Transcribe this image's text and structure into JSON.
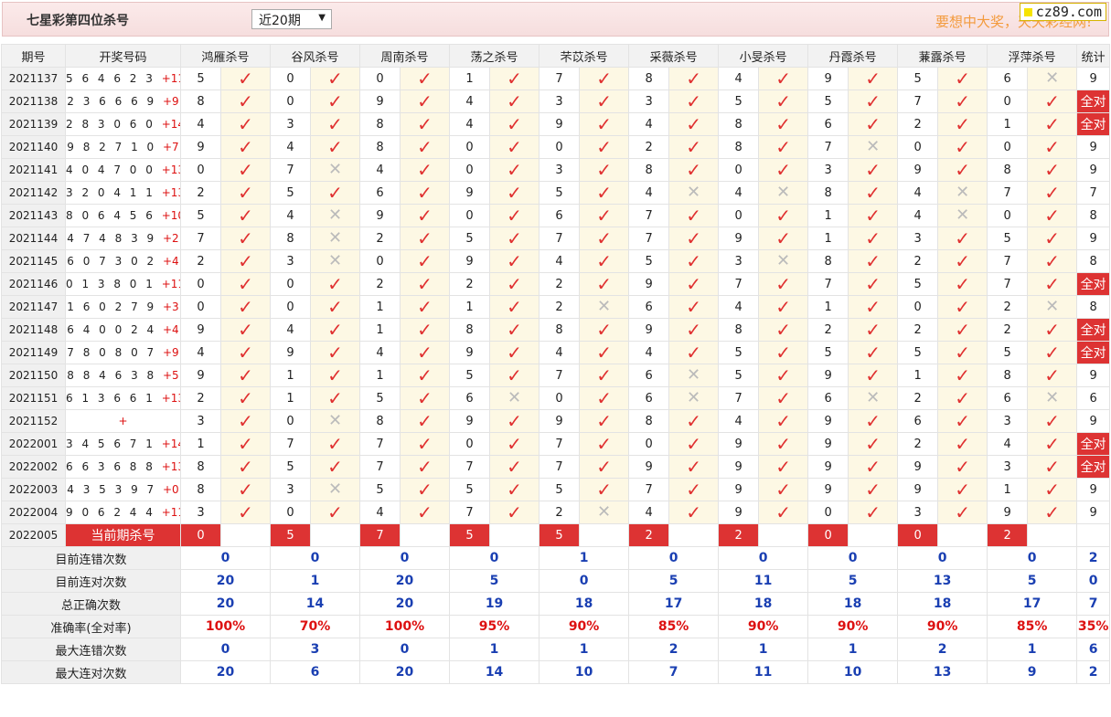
{
  "header": {
    "title": "七星彩第四位杀号",
    "period_select": "近20期",
    "slogan": "要想中大奖，天天彩经网!",
    "site": "cz89.com"
  },
  "columns": {
    "issue": "期号",
    "numbers": "开奖号码",
    "experts": [
      "鸿雁杀号",
      "谷风杀号",
      "周南杀号",
      "荡之杀号",
      "芣苡杀号",
      "采薇杀号",
      "小旻杀号",
      "丹霞杀号",
      "蒹露杀号",
      "浮萍杀号"
    ],
    "stat": "统计"
  },
  "rows": [
    {
      "issue": "2021137",
      "nums": "5 6 4 6 2 3",
      "sum": "+11",
      "preds": [
        "5",
        "0",
        "0",
        "1",
        "7",
        "8",
        "4",
        "9",
        "5",
        "6"
      ],
      "res": [
        1,
        1,
        1,
        1,
        1,
        1,
        1,
        1,
        1,
        0
      ],
      "stat": "9"
    },
    {
      "issue": "2021138",
      "nums": "2 3 6 6 6 9",
      "sum": "+9",
      "preds": [
        "8",
        "0",
        "9",
        "4",
        "3",
        "3",
        "5",
        "5",
        "7",
        "0"
      ],
      "res": [
        1,
        1,
        1,
        1,
        1,
        1,
        1,
        1,
        1,
        1
      ],
      "stat": "全对"
    },
    {
      "issue": "2021139",
      "nums": "2 8 3 0 6 0",
      "sum": "+14",
      "preds": [
        "4",
        "3",
        "8",
        "4",
        "9",
        "4",
        "8",
        "6",
        "2",
        "1"
      ],
      "res": [
        1,
        1,
        1,
        1,
        1,
        1,
        1,
        1,
        1,
        1
      ],
      "stat": "全对"
    },
    {
      "issue": "2021140",
      "nums": "9 8 2 7 1 0",
      "sum": "+7",
      "preds": [
        "9",
        "4",
        "8",
        "0",
        "0",
        "2",
        "8",
        "7",
        "0",
        "0"
      ],
      "res": [
        1,
        1,
        1,
        1,
        1,
        1,
        1,
        0,
        1,
        1
      ],
      "stat": "9"
    },
    {
      "issue": "2021141",
      "nums": "4 0 4 7 0 0",
      "sum": "+13",
      "preds": [
        "0",
        "7",
        "4",
        "0",
        "3",
        "8",
        "0",
        "3",
        "9",
        "8"
      ],
      "res": [
        1,
        0,
        1,
        1,
        1,
        1,
        1,
        1,
        1,
        1
      ],
      "stat": "9"
    },
    {
      "issue": "2021142",
      "nums": "3 2 0 4 1 1",
      "sum": "+13",
      "preds": [
        "2",
        "5",
        "6",
        "9",
        "5",
        "4",
        "4",
        "8",
        "4",
        "7"
      ],
      "res": [
        1,
        1,
        1,
        1,
        1,
        0,
        0,
        1,
        0,
        1
      ],
      "stat": "7"
    },
    {
      "issue": "2021143",
      "nums": "8 0 6 4 5 6",
      "sum": "+10",
      "preds": [
        "5",
        "4",
        "9",
        "0",
        "6",
        "7",
        "0",
        "1",
        "4",
        "0"
      ],
      "res": [
        1,
        0,
        1,
        1,
        1,
        1,
        1,
        1,
        0,
        1
      ],
      "stat": "8"
    },
    {
      "issue": "2021144",
      "nums": "4 7 4 8 3 9",
      "sum": "+2",
      "preds": [
        "7",
        "8",
        "2",
        "5",
        "7",
        "7",
        "9",
        "1",
        "3",
        "5"
      ],
      "res": [
        1,
        0,
        1,
        1,
        1,
        1,
        1,
        1,
        1,
        1
      ],
      "stat": "9"
    },
    {
      "issue": "2021145",
      "nums": "6 0 7 3 0 2",
      "sum": "+4",
      "preds": [
        "2",
        "3",
        "0",
        "9",
        "4",
        "5",
        "3",
        "8",
        "2",
        "7"
      ],
      "res": [
        1,
        0,
        1,
        1,
        1,
        1,
        0,
        1,
        1,
        1
      ],
      "stat": "8"
    },
    {
      "issue": "2021146",
      "nums": "0 1 3 8 0 1",
      "sum": "+11",
      "preds": [
        "0",
        "0",
        "2",
        "2",
        "2",
        "9",
        "7",
        "7",
        "5",
        "7"
      ],
      "res": [
        1,
        1,
        1,
        1,
        1,
        1,
        1,
        1,
        1,
        1
      ],
      "stat": "全对"
    },
    {
      "issue": "2021147",
      "nums": "1 6 0 2 7 9",
      "sum": "+3",
      "preds": [
        "0",
        "0",
        "1",
        "1",
        "2",
        "6",
        "4",
        "1",
        "0",
        "2"
      ],
      "res": [
        1,
        1,
        1,
        1,
        0,
        1,
        1,
        1,
        1,
        0
      ],
      "stat": "8"
    },
    {
      "issue": "2021148",
      "nums": "6 4 0 0 2 4",
      "sum": "+4",
      "preds": [
        "9",
        "4",
        "1",
        "8",
        "8",
        "9",
        "8",
        "2",
        "2",
        "2"
      ],
      "res": [
        1,
        1,
        1,
        1,
        1,
        1,
        1,
        1,
        1,
        1
      ],
      "stat": "全对"
    },
    {
      "issue": "2021149",
      "nums": "7 8 0 8 0 7",
      "sum": "+9",
      "preds": [
        "4",
        "9",
        "4",
        "9",
        "4",
        "4",
        "5",
        "5",
        "5",
        "5"
      ],
      "res": [
        1,
        1,
        1,
        1,
        1,
        1,
        1,
        1,
        1,
        1
      ],
      "stat": "全对"
    },
    {
      "issue": "2021150",
      "nums": "8 8 4 6 3 8",
      "sum": "+5",
      "preds": [
        "9",
        "1",
        "1",
        "5",
        "7",
        "6",
        "5",
        "9",
        "1",
        "8"
      ],
      "res": [
        1,
        1,
        1,
        1,
        1,
        0,
        1,
        1,
        1,
        1
      ],
      "stat": "9"
    },
    {
      "issue": "2021151",
      "nums": "6 1 3 6 6 1",
      "sum": "+13",
      "preds": [
        "2",
        "1",
        "5",
        "6",
        "0",
        "6",
        "7",
        "6",
        "2",
        "6"
      ],
      "res": [
        1,
        1,
        1,
        0,
        1,
        0,
        1,
        0,
        1,
        0
      ],
      "stat": "6"
    },
    {
      "issue": "2021152",
      "nums": "",
      "sum": "+",
      "preds": [
        "3",
        "0",
        "8",
        "9",
        "9",
        "8",
        "4",
        "9",
        "6",
        "3"
      ],
      "res": [
        1,
        0,
        1,
        1,
        1,
        1,
        1,
        1,
        1,
        1
      ],
      "stat": "9"
    },
    {
      "issue": "2022001",
      "nums": "3 4 5 6 7 1",
      "sum": "+14",
      "preds": [
        "1",
        "7",
        "7",
        "0",
        "7",
        "0",
        "9",
        "9",
        "2",
        "4"
      ],
      "res": [
        1,
        1,
        1,
        1,
        1,
        1,
        1,
        1,
        1,
        1
      ],
      "stat": "全对"
    },
    {
      "issue": "2022002",
      "nums": "6 6 3 6 8 8",
      "sum": "+13",
      "preds": [
        "8",
        "5",
        "7",
        "7",
        "7",
        "9",
        "9",
        "9",
        "9",
        "3"
      ],
      "res": [
        1,
        1,
        1,
        1,
        1,
        1,
        1,
        1,
        1,
        1
      ],
      "stat": "全对"
    },
    {
      "issue": "2022003",
      "nums": "4 3 5 3 9 7",
      "sum": "+0",
      "preds": [
        "8",
        "3",
        "5",
        "5",
        "5",
        "7",
        "9",
        "9",
        "9",
        "1"
      ],
      "res": [
        1,
        0,
        1,
        1,
        1,
        1,
        1,
        1,
        1,
        1
      ],
      "stat": "9"
    },
    {
      "issue": "2022004",
      "nums": "9 0 6 2 4 4",
      "sum": "+11",
      "preds": [
        "3",
        "0",
        "4",
        "7",
        "2",
        "4",
        "9",
        "0",
        "3",
        "9"
      ],
      "res": [
        1,
        1,
        1,
        1,
        0,
        1,
        1,
        1,
        1,
        1
      ],
      "stat": "9"
    }
  ],
  "current": {
    "issue": "2022005",
    "label": "当前期杀号",
    "preds": [
      "0",
      "5",
      "7",
      "5",
      "5",
      "2",
      "2",
      "0",
      "0",
      "2"
    ]
  },
  "stats": [
    {
      "label": "目前连错次数",
      "vals": [
        "0",
        "0",
        "0",
        "0",
        "1",
        "0",
        "0",
        "0",
        "0",
        "0"
      ],
      "total": "2",
      "red": false
    },
    {
      "label": "目前连对次数",
      "vals": [
        "20",
        "1",
        "20",
        "5",
        "0",
        "5",
        "11",
        "5",
        "13",
        "5"
      ],
      "total": "0",
      "red": false
    },
    {
      "label": "总正确次数",
      "vals": [
        "20",
        "14",
        "20",
        "19",
        "18",
        "17",
        "18",
        "18",
        "18",
        "17"
      ],
      "total": "7",
      "red": false
    },
    {
      "label": "准确率(全对率)",
      "vals": [
        "100%",
        "70%",
        "100%",
        "95%",
        "90%",
        "85%",
        "90%",
        "90%",
        "90%",
        "85%"
      ],
      "total": "35%",
      "red": true
    },
    {
      "label": "最大连错次数",
      "vals": [
        "0",
        "3",
        "0",
        "1",
        "1",
        "2",
        "1",
        "1",
        "2",
        "1"
      ],
      "total": "6",
      "red": false
    },
    {
      "label": "最大连对次数",
      "vals": [
        "20",
        "6",
        "20",
        "14",
        "10",
        "7",
        "11",
        "10",
        "13",
        "9"
      ],
      "total": "2",
      "red": false
    }
  ],
  "marks": {
    "ok": "✓",
    "no": "✕"
  }
}
